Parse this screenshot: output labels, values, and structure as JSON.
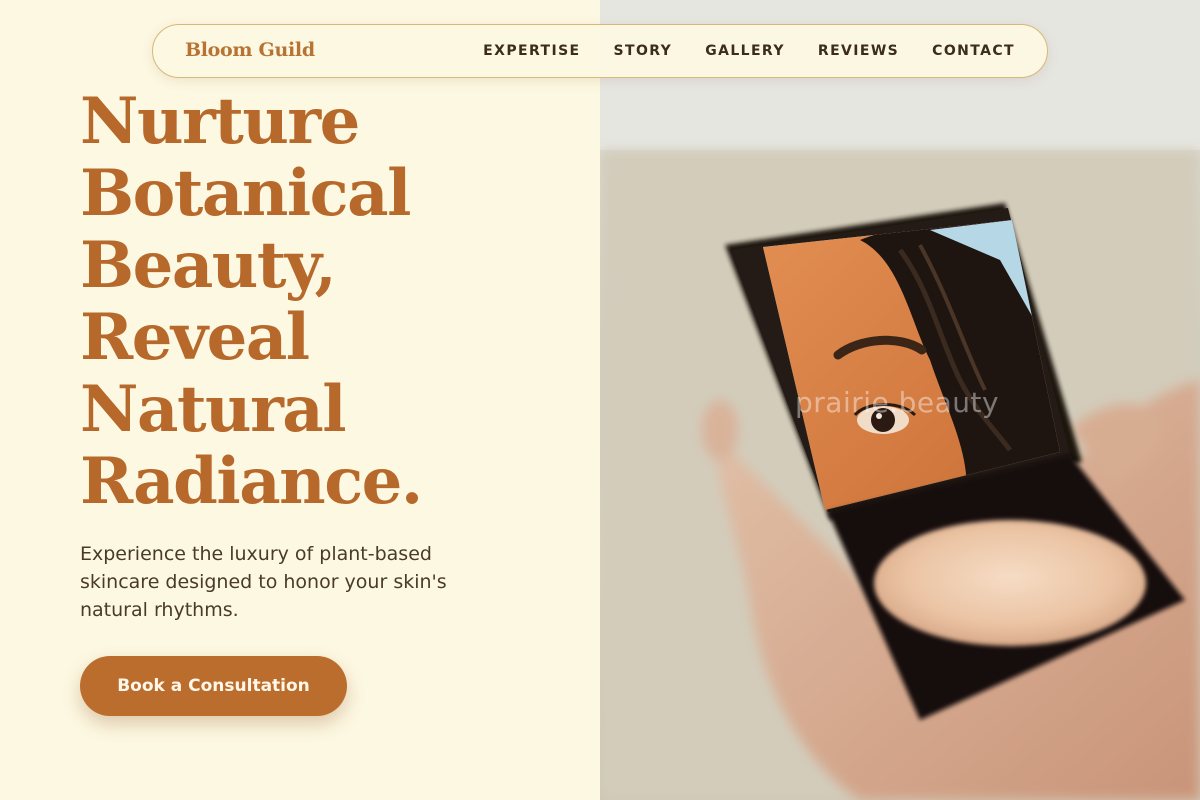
{
  "brand": {
    "name": "Bloom Guild"
  },
  "nav": {
    "links": [
      "EXPERTISE",
      "STORY",
      "GALLERY",
      "REVIEWS",
      "CONTACT"
    ]
  },
  "hero": {
    "title_lines": [
      "Nurture",
      "Botanical",
      "Beauty,",
      "Reveal",
      "Natural",
      "Radiance."
    ],
    "subtitle": "Experience the luxury of plant-based skincare designed to honor your skin's natural rhythms.",
    "cta_label": "Book a Consultation"
  },
  "image": {
    "watermark": "prairie.beauty"
  },
  "colors": {
    "background": "#fdf8e2",
    "accent": "#b7692b",
    "button": "#bb6d2d",
    "text": "#4a3a2a"
  }
}
